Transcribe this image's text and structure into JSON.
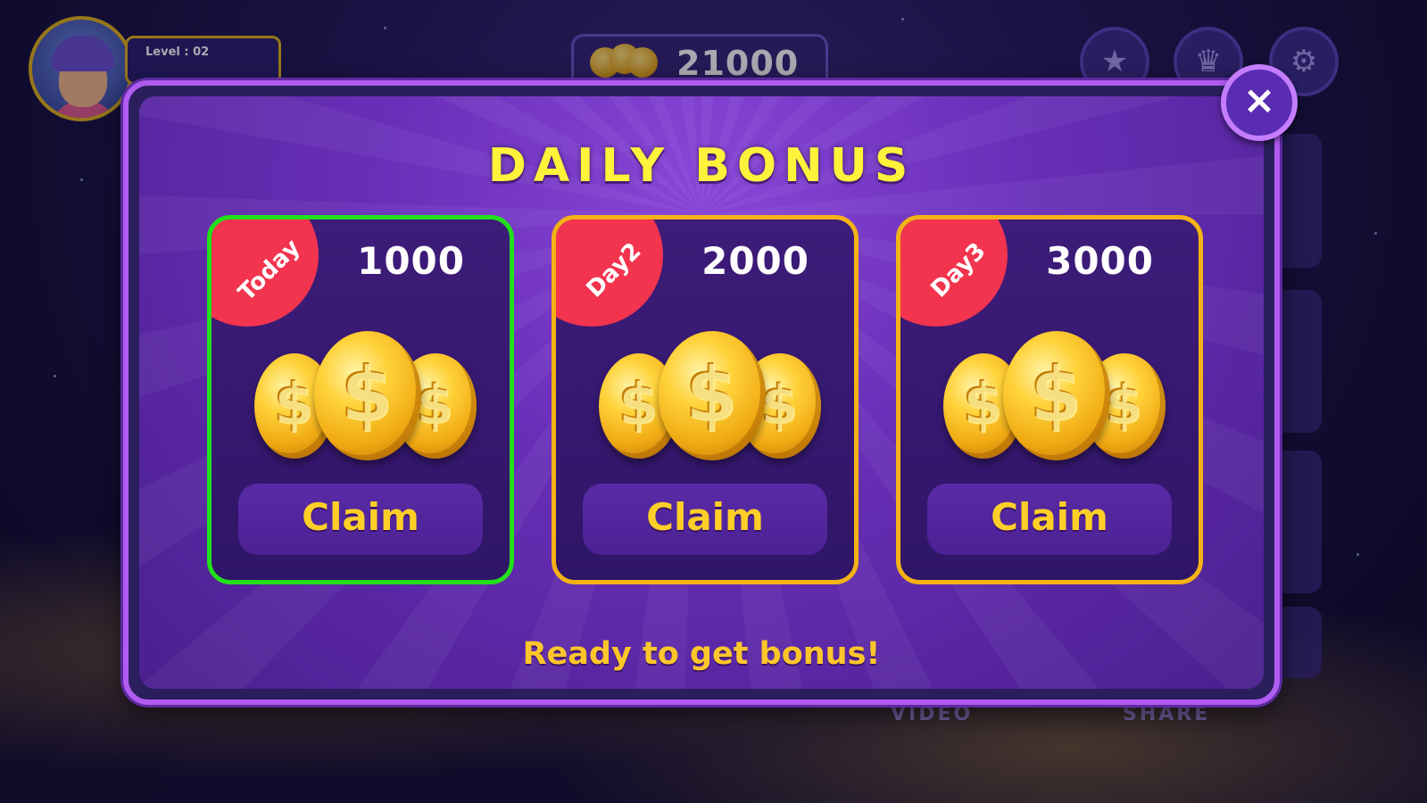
{
  "hud": {
    "level_label": "Level : 02",
    "coin_total": "21000",
    "star_icon": "star-icon",
    "trophy_icon": "trophy-icon",
    "settings_icon": "gear-icon"
  },
  "dialog": {
    "title": "DAILY BONUS",
    "close_label": "×",
    "footer_message": "Ready to get bonus!",
    "cards": [
      {
        "day": "Today",
        "amount": "1000",
        "claim_label": "Claim",
        "state": "active",
        "border_color": "#22e01a"
      },
      {
        "day": "Day2",
        "amount": "2000",
        "claim_label": "Claim",
        "state": "locked",
        "border_color": "#f4b216"
      },
      {
        "day": "Day3",
        "amount": "3000",
        "claim_label": "Claim",
        "state": "locked",
        "border_color": "#f4b216"
      }
    ]
  },
  "background": {
    "bottom_labels": [
      "VIDEO",
      "SHARE"
    ]
  },
  "colors": {
    "title_yellow": "#fff23a",
    "ribbon_red": "#f2344e",
    "dialog_border": "#b05cf0",
    "claim_text": "#ffcf28"
  }
}
